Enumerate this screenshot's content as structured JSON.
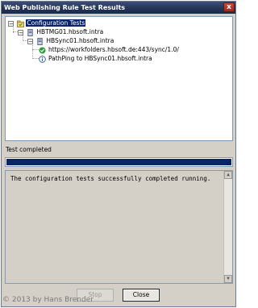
{
  "window": {
    "title": "Web Publishing Rule Test Results",
    "close_glyph": "x"
  },
  "tree": {
    "root": {
      "label": "Configuration Tests",
      "expander": "−",
      "icon": "test-folder-icon"
    },
    "server": {
      "label": "HBTMG01.hbsoft.intra",
      "expander": "−",
      "icon": "server-icon"
    },
    "target": {
      "label": "HBSync01.hbsoft.intra",
      "expander": "−",
      "icon": "server-icon"
    },
    "results": [
      {
        "label": "https://workfolders.hbsoft.de:443/sync/1.0/",
        "icon": "success-check-icon"
      },
      {
        "label": "PathPing to HBSync01.hbsoft.intra",
        "icon": "info-icon"
      }
    ]
  },
  "status": {
    "text": "Test completed",
    "progress": 1.0
  },
  "output": {
    "text": "The configuration tests successfully completed running."
  },
  "buttons": {
    "stop": "Stop",
    "close": "Close"
  },
  "watermark": "© 2013 by Hans Brender",
  "colors": {
    "accent": "#0a246a",
    "title_bar": "#223356",
    "success": "#2e9e3a",
    "info": "#2a5fc4"
  }
}
